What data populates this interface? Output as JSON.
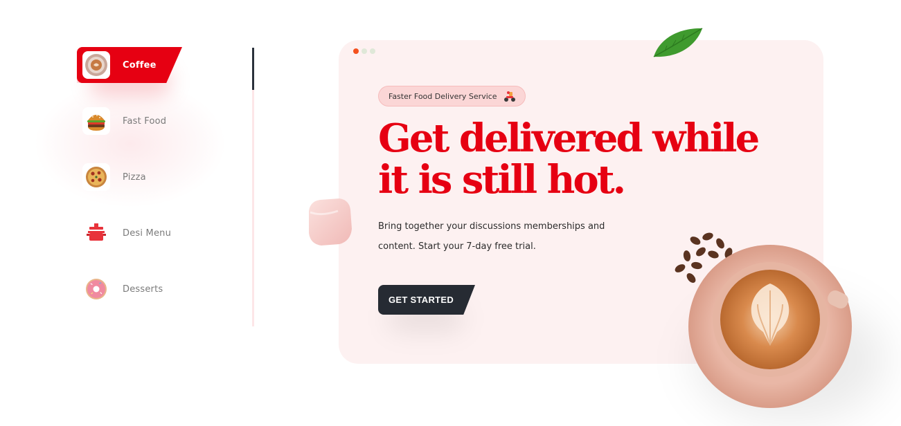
{
  "sidebar": {
    "items": [
      {
        "label": "Coffee",
        "icon": "coffee-icon",
        "active": true
      },
      {
        "label": "Fast Food",
        "icon": "burger-icon",
        "active": false
      },
      {
        "label": "Pizza",
        "icon": "pizza-icon",
        "active": false
      },
      {
        "label": "Desi Menu",
        "icon": "pot-icon",
        "active": false
      },
      {
        "label": "Desserts",
        "icon": "donut-icon",
        "active": false
      }
    ]
  },
  "hero": {
    "badge": "Faster Food Delivery Service",
    "badge_icon": "delivery-scooter-icon",
    "headline": "Get delivered while it is still hot.",
    "subtext": "Bring together your discussions memberships and content. Start your 7-day free trial.",
    "cta_label": "GET STARTED",
    "window_dots": [
      "#f4511e",
      "#dfe8d8",
      "#dfe8d8"
    ]
  },
  "colors": {
    "brand": "#e60012",
    "card_bg": "#fdf1f1",
    "cta_bg": "#262b33",
    "divider_active": "#2b313b"
  }
}
